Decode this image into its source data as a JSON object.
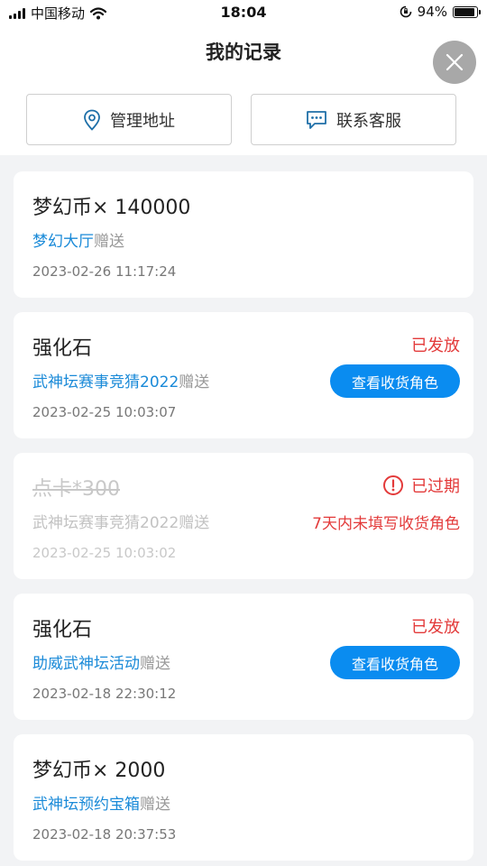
{
  "status_bar": {
    "carrier": "中国移动",
    "time": "18:04",
    "battery": "94%"
  },
  "page": {
    "title": "我的记录"
  },
  "actions": {
    "address": "管理地址",
    "service": "联系客服"
  },
  "records": [
    {
      "name": "梦幻币× 140000",
      "source_link": "梦幻大厅",
      "source_suffix": "赠送",
      "time": "2023-02-26 11:17:24"
    },
    {
      "name": "强化石",
      "source_link": "武神坛赛事竞猜2022",
      "source_suffix": "赠送",
      "time": "2023-02-25 10:03:07",
      "status": "已发放",
      "button": "查看收货角色"
    },
    {
      "name": "点卡*300",
      "source_link": "武神坛赛事竞猜2022",
      "source_suffix": "赠送",
      "time": "2023-02-25 10:03:02",
      "status": "已过期",
      "warning": "7天内未填写收货角色"
    },
    {
      "name": "强化石",
      "source_link": "助威武神坛活动",
      "source_suffix": "赠送",
      "time": "2023-02-18 22:30:12",
      "status": "已发放",
      "button": "查看收货角色"
    },
    {
      "name": "梦幻币× 2000",
      "source_link": "武神坛预约宝箱",
      "source_suffix": "赠送",
      "time": "2023-02-18 20:37:53"
    }
  ],
  "colors": {
    "link": "#1a8ad8",
    "accent": "#0a8cf0",
    "alert": "#e33a3a"
  },
  "icons": {
    "address": "location-pin-icon",
    "service": "chat-bubble-icon",
    "close": "close-icon",
    "expired": "exclamation-circle-icon"
  }
}
